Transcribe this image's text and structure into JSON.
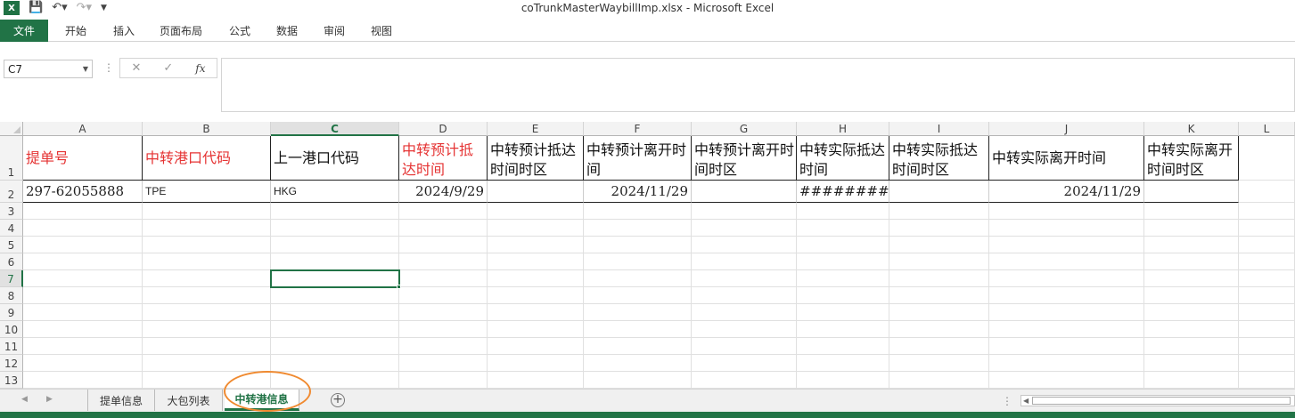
{
  "window": {
    "title": "coTrunkMasterWaybillImp.xlsx - Microsoft Excel"
  },
  "qat": {
    "logo": "X"
  },
  "ribbon": {
    "file_label": "文件",
    "tabs": [
      "开始",
      "插入",
      "页面布局",
      "公式",
      "数据",
      "审阅",
      "视图"
    ]
  },
  "formula_bar": {
    "name_box": "C7",
    "fx": "fx",
    "cancel": "✕",
    "enter": "✓",
    "content": ""
  },
  "columns": [
    "A",
    "B",
    "C",
    "D",
    "E",
    "F",
    "G",
    "H",
    "I",
    "J",
    "K",
    "L"
  ],
  "active_column": "C",
  "active_row": "7",
  "rows": [
    "1",
    "2",
    "3",
    "4",
    "5",
    "6",
    "7",
    "8",
    "9",
    "10",
    "11",
    "12",
    "13"
  ],
  "header_row": [
    {
      "text": "提单号",
      "color": "#e53333"
    },
    {
      "text": "中转港口代码",
      "color": "#e53333"
    },
    {
      "text": "上一港口代码",
      "color": "#111111"
    },
    {
      "text": "中转预计抵达时间",
      "color": "#e53333"
    },
    {
      "text": "中转预计抵达时间时区",
      "color": "#111111"
    },
    {
      "text": "中转预计离开时间",
      "color": "#111111"
    },
    {
      "text": "中转预计离开时间时区",
      "color": "#111111"
    },
    {
      "text": "中转实际抵达时间",
      "color": "#111111"
    },
    {
      "text": "中转实际抵达时间时区",
      "color": "#111111"
    },
    {
      "text": "中转实际离开时间",
      "color": "#111111"
    },
    {
      "text": "中转实际离开时间时区",
      "color": "#111111"
    }
  ],
  "data_row": [
    "297-62055888",
    "TPE",
    "HKG",
    "2024/9/29",
    "",
    "2024/11/29",
    "",
    "#########",
    "",
    "2024/11/29",
    ""
  ],
  "sheets": [
    {
      "label": "提单信息",
      "active": false
    },
    {
      "label": "大包列表",
      "active": false
    },
    {
      "label": "中转港信息",
      "active": true
    }
  ],
  "add_sheet": "+",
  "accent_color": "#217346",
  "annotation_color": "#f08a30"
}
